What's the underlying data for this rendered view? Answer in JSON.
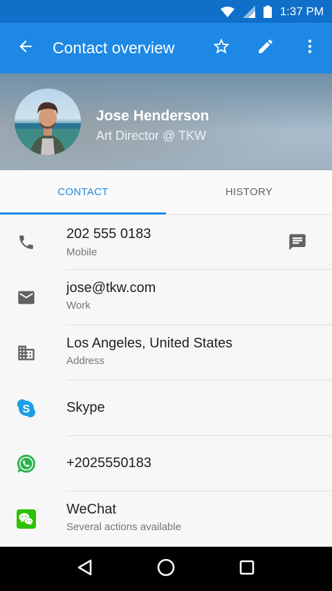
{
  "status_bar": {
    "time": "1:37 PM",
    "icons": [
      "wifi-icon",
      "signal-icon",
      "battery-icon"
    ]
  },
  "app_bar": {
    "title": "Contact overview",
    "icons": [
      "back-arrow-icon",
      "star-outline-icon",
      "edit-pencil-icon",
      "more-vert-icon"
    ]
  },
  "contact": {
    "name": "Jose Henderson",
    "role": "Art Director @ TKW"
  },
  "tabs": [
    {
      "label": "CONTACT",
      "active": true
    },
    {
      "label": "HISTORY",
      "active": false
    }
  ],
  "items": [
    {
      "icon": "phone-icon",
      "primary": "202 555 0183",
      "secondary": "Mobile",
      "trailing_icon": "message-icon"
    },
    {
      "icon": "email-icon",
      "primary": "jose@tkw.com",
      "secondary": "Work"
    },
    {
      "icon": "building-icon",
      "primary": "Los Angeles, United States",
      "secondary": "Address"
    },
    {
      "icon": "skype-icon",
      "primary": "Skype"
    },
    {
      "icon": "whatsapp-icon",
      "primary": "+2025550183"
    },
    {
      "icon": "wechat-icon",
      "primary": "WeChat",
      "secondary": "Several actions available"
    }
  ],
  "colors": {
    "primary": "#1e88e5",
    "status_bar": "#0f6fc9",
    "skype": "#1e9fe5",
    "whatsapp": "#29b34a",
    "wechat": "#2dc100",
    "icon_grey": "#616161"
  },
  "nav_bar": {
    "icons": [
      "back-triangle-icon",
      "home-circle-icon",
      "recents-square-icon"
    ]
  }
}
